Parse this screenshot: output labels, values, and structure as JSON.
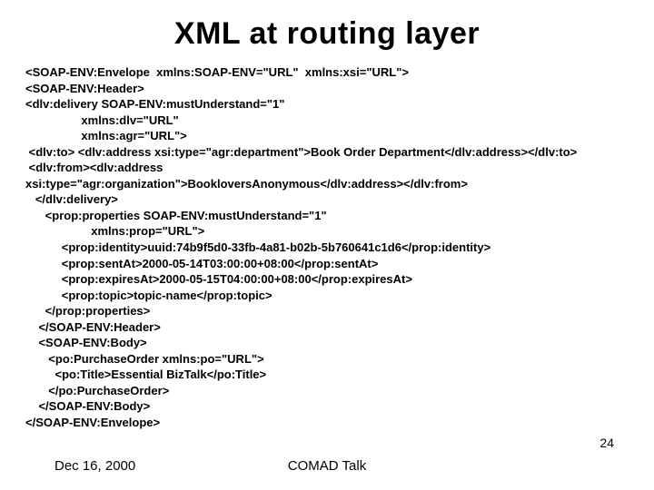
{
  "title": "XML at routing layer",
  "code_lines": [
    "<SOAP-ENV:Envelope  xmlns:SOAP-ENV=\"URL\"  xmlns:xsi=\"URL\">",
    "<SOAP-ENV:Header>",
    "<dlv:delivery SOAP-ENV:mustUnderstand=\"1\"",
    "                 xmlns:dlv=\"URL\"",
    "                 xmlns:agr=\"URL\">",
    " <dlv:to> <dlv:address xsi:type=\"agr:department\">Book Order Department</dlv:address></dlv:to>",
    " <dlv:from><dlv:address",
    "xsi:type=\"agr:organization\">BookloversAnonymous</dlv:address></dlv:from>",
    "   </dlv:delivery>",
    "      <prop:properties SOAP-ENV:mustUnderstand=\"1\"",
    "                    xmlns:prop=\"URL\">",
    "           <prop:identity>uuid:74b9f5d0-33fb-4a81-b02b-5b760641c1d6</prop:identity>",
    "           <prop:sentAt>2000-05-14T03:00:00+08:00</prop:sentAt>",
    "           <prop:expiresAt>2000-05-15T04:00:00+08:00</prop:expiresAt>",
    "           <prop:topic>topic-name</prop:topic>",
    "      </prop:properties>",
    "    </SOAP-ENV:Header>",
    "    <SOAP-ENV:Body>",
    "       <po:PurchaseOrder xmlns:po=\"URL\">",
    "         <po:Title>Essential BizTalk</po:Title>",
    "       </po:PurchaseOrder>",
    "    </SOAP-ENV:Body>",
    "</SOAP-ENV:Envelope>"
  ],
  "footer": {
    "date": "Dec 16, 2000",
    "talk": "COMAD Talk"
  },
  "page_number": "24"
}
